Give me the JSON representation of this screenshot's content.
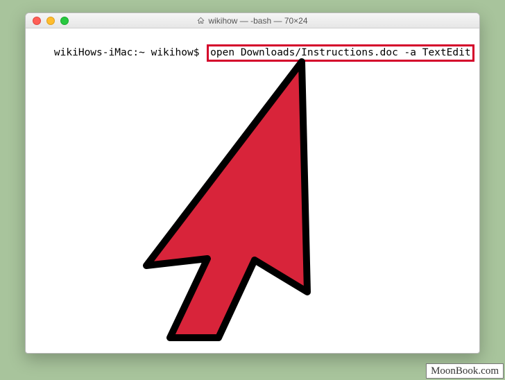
{
  "window": {
    "title": "wikihow — -bash — 70×24"
  },
  "terminal": {
    "prompt": "wikiHows-iMac:~ wikihow$",
    "command": "open Downloads/Instructions.doc -a TextEdit"
  },
  "watermark": {
    "text": "MoonBook.com"
  },
  "traffic_lights": {
    "close": "close",
    "minimize": "minimize",
    "zoom": "zoom"
  }
}
